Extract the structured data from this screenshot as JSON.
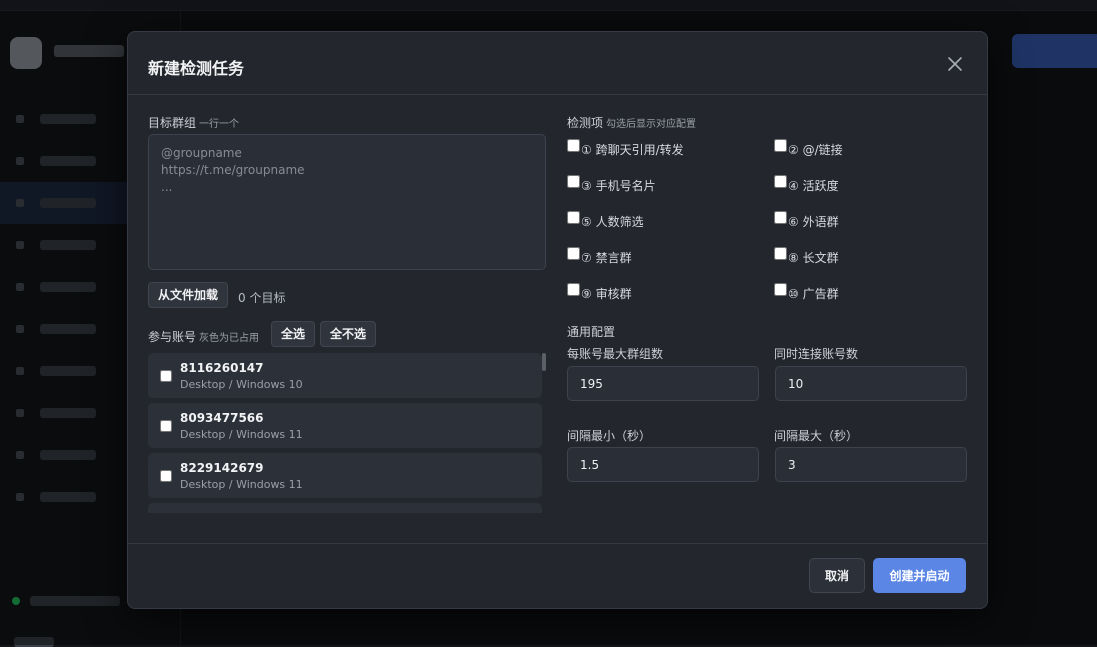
{
  "modal": {
    "title": "新建检测任务",
    "target_groups": {
      "label": "目标群组",
      "hint": "一行一个",
      "placeholder": "@groupname\nhttps://t.me/groupname\n...",
      "load_file_button": "从文件加载",
      "count_text": "0 个目标"
    },
    "accounts": {
      "label": "参与账号",
      "hint": "灰色为已占用",
      "select_all_button": "全选",
      "select_none_button": "全不选",
      "items": [
        {
          "number": "8116260147",
          "os": "Desktop / Windows 10"
        },
        {
          "number": "8093477566",
          "os": "Desktop / Windows 11"
        },
        {
          "number": "8229142679",
          "os": "Desktop / Windows 11"
        },
        {
          "number": "",
          "os": ""
        }
      ]
    },
    "checks": {
      "label": "检测项",
      "hint": "勾选后显示对应配置",
      "items": [
        {
          "label": "① 跨聊天引用/转发",
          "checked": false
        },
        {
          "label": "② @/链接",
          "checked": false
        },
        {
          "label": "③ 手机号名片",
          "checked": false
        },
        {
          "label": "④ 活跃度",
          "checked": false
        },
        {
          "label": "⑤ 人数筛选",
          "checked": false
        },
        {
          "label": "⑥ 外语群",
          "checked": false
        },
        {
          "label": "⑦ 禁言群",
          "checked": false
        },
        {
          "label": "⑧ 长文群",
          "checked": false
        },
        {
          "label": "⑨ 审核群",
          "checked": false
        },
        {
          "label": "⑩ 广告群",
          "checked": false
        }
      ]
    },
    "general": {
      "label": "通用配置",
      "max_groups_label": "每账号最大群组数",
      "max_groups_value": "195",
      "concurrent_label": "同时连接账号数",
      "concurrent_value": "10",
      "interval_min_label": "间隔最小（秒）",
      "interval_min_value": "1.5",
      "interval_max_label": "间隔最大（秒）",
      "interval_max_value": "3"
    },
    "footer": {
      "cancel_button": "取消",
      "submit_button": "创建并启动"
    }
  },
  "colors": {
    "primary": "#5b86e6",
    "modal_bg": "#23262d",
    "status_online": "#22c55e"
  }
}
